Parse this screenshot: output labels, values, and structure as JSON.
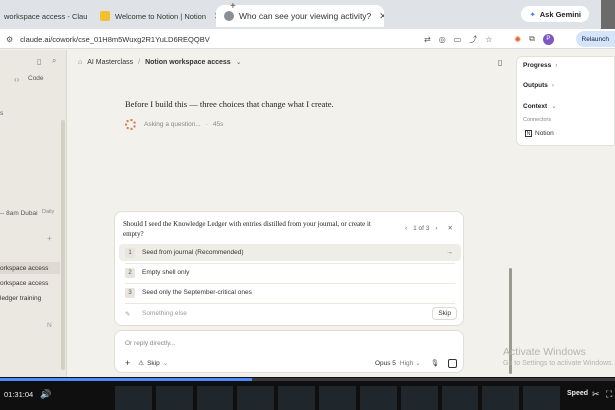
{
  "browser": {
    "tabs": [
      {
        "title": "workspace access - Clau",
        "active": false
      },
      {
        "title": "Welcome to Notion | Notion",
        "active": false
      },
      {
        "title": "Who can see your viewing activity?",
        "active": true
      }
    ],
    "ask_gemini_label": "Ask Gemini",
    "url": "claude.ai/cowork/cse_01H8m5Wuxg2R1YuLD6REQQBV",
    "relaunch_label": "Relaunch",
    "profile_initial": "P"
  },
  "sidebar": {
    "code_tab": "Code",
    "partial_text_1": "s",
    "schedule_item": "-- 8am Dubai",
    "schedule_badge": "Daily",
    "items": [
      {
        "label": "orkspace access",
        "selected": true
      },
      {
        "label": "orkspace access",
        "selected": false
      },
      {
        "label": "ledger training",
        "selected": false
      }
    ],
    "partial_n": "N"
  },
  "header": {
    "breadcrumb_root": "AI Masterclass",
    "breadcrumb_separator": "/",
    "breadcrumb_current": "Notion workspace access"
  },
  "conversation": {
    "heading": "Before I build this — three choices that change what I create.",
    "status": "Asking a question...",
    "status_time": "45s"
  },
  "question": {
    "text": "Should I seed the Knowledge Ledger with entries distilled from your journal, or create it empty?",
    "pager": "1 of 3",
    "options": [
      {
        "num": "1",
        "label": "Seed from journal (Recommended)"
      },
      {
        "num": "2",
        "label": "Empty shell only"
      },
      {
        "num": "3",
        "label": "Seed only the September-critical ones"
      }
    ],
    "other_placeholder": "Something else",
    "skip_label": "Skip"
  },
  "reply": {
    "placeholder": "Or reply directly...",
    "skip_label": "Skip",
    "model": "Opus 5",
    "effort": "High"
  },
  "right_panel": {
    "progress_label": "Progress",
    "outputs_label": "Outputs",
    "context_label": "Context",
    "connectors_label": "Connectors",
    "connector_name": "Notion"
  },
  "watermark": {
    "line1": "Activate Windows",
    "line2": "Go to Settings to activate Windows."
  },
  "player": {
    "time": "01:31:04",
    "speed_label": "Speed",
    "progress_fraction": 0.41
  }
}
